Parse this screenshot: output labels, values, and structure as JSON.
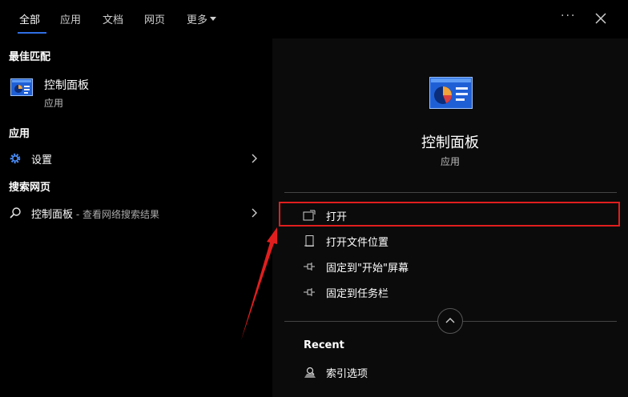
{
  "tabs": [
    {
      "label": "全部",
      "active": true
    },
    {
      "label": "应用"
    },
    {
      "label": "文档"
    },
    {
      "label": "网页"
    },
    {
      "label": "更多"
    }
  ],
  "header": {
    "more_dots": "···"
  },
  "best_match": {
    "section_title": "最佳匹配",
    "title": "控制面板",
    "subtitle": "应用",
    "icon": "control-panel-icon"
  },
  "apps": {
    "section_title": "应用",
    "items": [
      {
        "label": "设置",
        "icon": "gear-icon"
      }
    ]
  },
  "web": {
    "section_title": "搜索网页",
    "items": [
      {
        "label": "控制面板",
        "suffix": " - 查看网络搜索结果",
        "icon": "search-icon"
      }
    ]
  },
  "detail": {
    "title": "控制面板",
    "subtitle": "应用",
    "actions": [
      {
        "label": "打开",
        "icon": "open-icon"
      },
      {
        "label": "打开文件位置",
        "icon": "file-location-icon"
      },
      {
        "label": "固定到\"开始\"屏幕",
        "icon": "pin-icon"
      },
      {
        "label": "固定到任务栏",
        "icon": "pin-icon"
      }
    ],
    "recent_title": "Recent",
    "recent_items": [
      {
        "label": "索引选项",
        "icon": "indexing-icon"
      }
    ]
  },
  "colors": {
    "accent": "#2f6fe4",
    "highlight": "#e11e1e",
    "background": "#000000"
  }
}
